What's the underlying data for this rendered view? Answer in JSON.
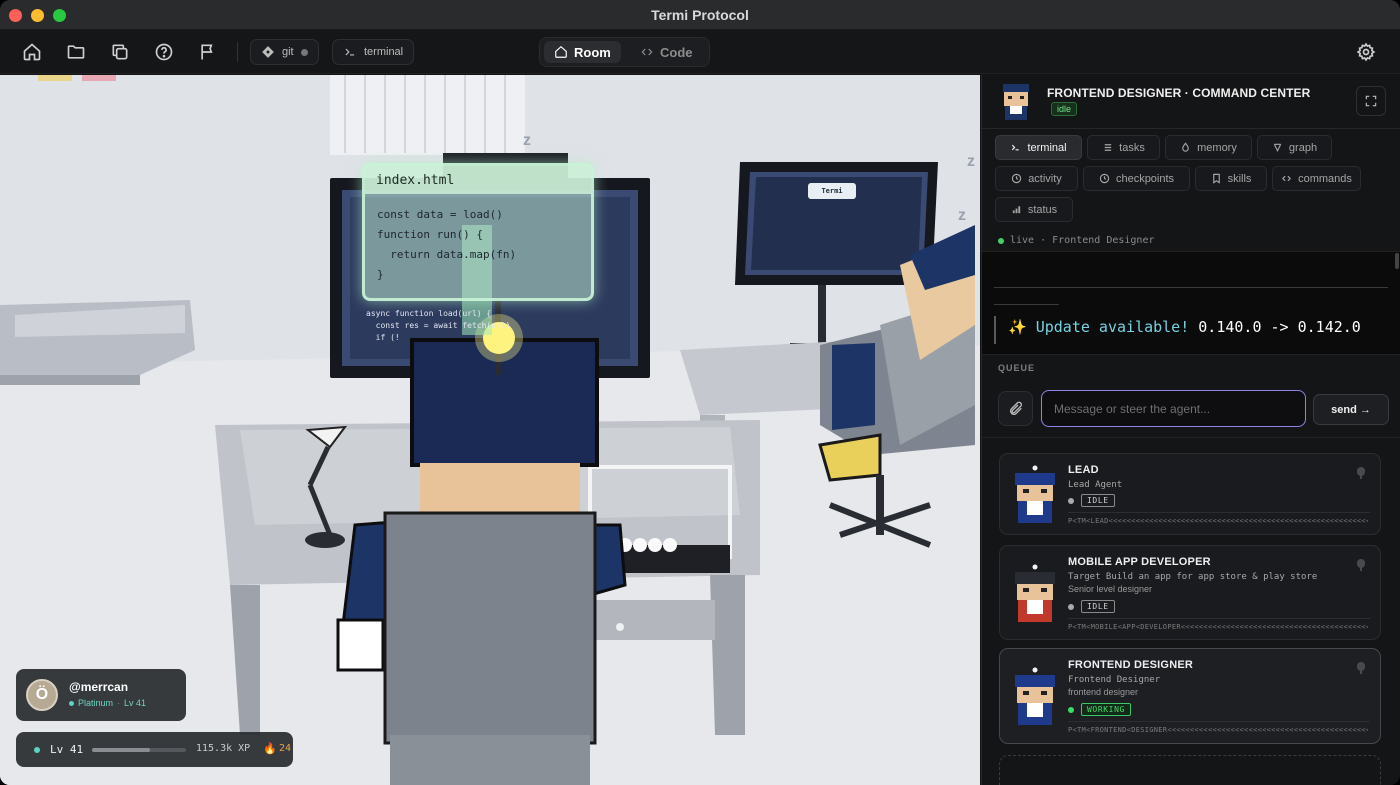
{
  "window": {
    "title": "Termi Protocol"
  },
  "toolbar": {
    "icons": [
      "home-icon",
      "folder-icon",
      "copy-icon",
      "help-icon",
      "flag-icon"
    ],
    "git_label": "git",
    "terminal_label": "terminal",
    "view_toggle": {
      "room_label": "Room",
      "code_label": "Code",
      "active": "Room"
    },
    "settings_icon": "gear-icon"
  },
  "scene": {
    "code_card": {
      "filename": "index.html",
      "lines": [
        "const data = load()",
        "function run() {",
        "  return data.map(fn)",
        "}"
      ]
    },
    "screen_code": [
      "async function load(url) {",
      "  const res = await fetch(url)",
      "  if (!"
    ],
    "small_screen_label": "Termi",
    "sleep_marks": [
      "z",
      "z",
      "z"
    ],
    "profile": {
      "initial": "Ö",
      "handle": "@merrcan",
      "tier": "Platinum",
      "level_text": "Lv 41"
    },
    "xp": {
      "level": "Lv 41",
      "xp_text": "115.3k XP",
      "progress": 0.62,
      "streak": "24",
      "fire_icon": "🔥"
    }
  },
  "panel": {
    "title": "FRONTEND DESIGNER · COMMAND CENTER",
    "status": "idle",
    "tabs": [
      {
        "label": "terminal",
        "icon": "terminal-icon",
        "active": true
      },
      {
        "label": "tasks",
        "icon": "list-icon",
        "active": false
      },
      {
        "label": "memory",
        "icon": "memory-icon",
        "active": false
      },
      {
        "label": "graph",
        "icon": "graph-icon",
        "active": false
      },
      {
        "label": "activity",
        "icon": "clock-icon",
        "active": false
      },
      {
        "label": "checkpoints",
        "icon": "checkpoint-icon",
        "active": false
      },
      {
        "label": "skills",
        "icon": "bookmark-icon",
        "active": false
      },
      {
        "label": "commands",
        "icon": "code-icon",
        "active": false
      },
      {
        "label": "status",
        "icon": "bars-icon",
        "active": false
      }
    ],
    "live_text": "live · Frontend Designer",
    "terminal": {
      "spark": "✨",
      "update_text": "Update available!",
      "version_text": "0.140.0 -> 0.142.0"
    },
    "queue_label": "QUEUE",
    "input": {
      "placeholder": "Message or steer the agent...",
      "value": ""
    },
    "send_label": "send →",
    "agents": [
      {
        "title": "LEAD",
        "subtitle": [
          "Lead Agent"
        ],
        "status": "IDLE",
        "marker": "P<TM<LEAD<<<<<<<<<<<<<<<<<<<<<<<<<<<<<<<<<<<<<<<<<<<<<<<<<<<<<<<<<<<<<<<<<<<<<<<<<<<<<<<<<<",
        "working": false,
        "active": false,
        "accent": "#1f3a8a"
      },
      {
        "title": "MOBILE APP DEVELOPER",
        "subtitle": [
          "Target Build an app for app store & play store",
          "Senior level designer"
        ],
        "status": "IDLE",
        "marker": "P<TM<MOBILE<APP<DEVELOPER<<<<<<<<<<<<<<<<<<<<<<<<<<<<<<<<<<<<<<<<<<<<<<<<<<<<<<<<<<<<<<<",
        "working": false,
        "active": false,
        "accent": "#c0392b"
      },
      {
        "title": "FRONTEND DESIGNER",
        "subtitle": [
          "Frontend Designer",
          "frontend designer"
        ],
        "status": "WORKING",
        "marker": "P<TM<FRONTEND<DESIGNER<<<<<<<<<<<<<<<<<<<<<<<<<<<<<<<<<<<<<<<<<<<<<<<<<<<<<<<<<<<<<<<<<<",
        "working": true,
        "active": true,
        "accent": "#1f3a8a"
      }
    ]
  }
}
